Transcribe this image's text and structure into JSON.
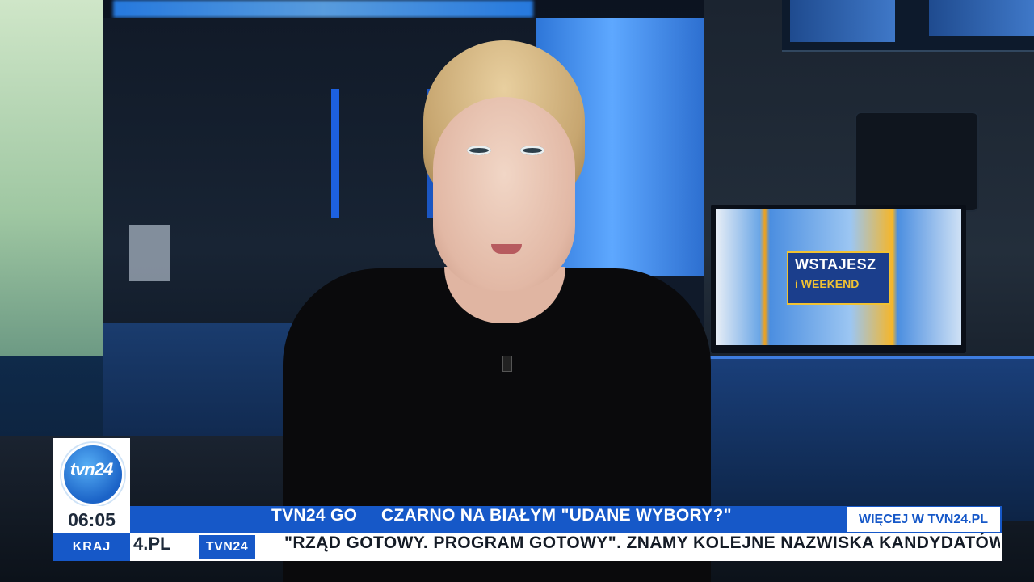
{
  "studio": {
    "screen_graphic": {
      "line1": "WSTAJESZ",
      "line2": "i WEEKEND"
    }
  },
  "overlay": {
    "logo_text": "tvn24",
    "clock": "06:05",
    "channel_name": "TVN24 GO",
    "program_title": "CZARNO NA BIAŁYM  \"UDANE WYBORY?\"",
    "more_link": "WIĘCEJ W TVN24.PL",
    "section_tag": "KRAJ",
    "url_fragment": "4.PL",
    "ticker_source": "TVN24",
    "ticker_headline": "\"RZĄD GOTOWY. PROGRAM GOTOWY\". ZNAMY KOLEJNE NAZWISKA KANDYDATÓW",
    "colors": {
      "brand_blue": "#1658c8",
      "white": "#ffffff",
      "dark_text": "#141b26"
    }
  }
}
